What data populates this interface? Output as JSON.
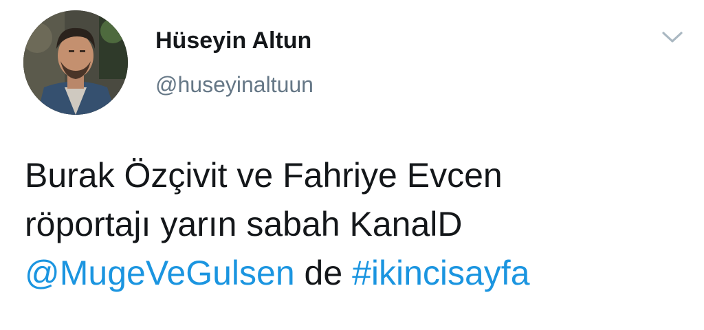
{
  "tweet": {
    "author_name": "Hüseyin Altun",
    "author_handle": "@huseyinaltuun",
    "menu_icon": "chevron-down-icon",
    "lines": [
      "Burak Özçivit ve Fahriye Evcen",
      "röportajı yarın sabah KanalD"
    ],
    "mention": "@MugeVeGulsen",
    "connector": " de ",
    "hashtag": "#ikincisayfa"
  },
  "colors": {
    "text": "#14171a",
    "secondary": "#657786",
    "link": "#1b95e0",
    "chevron": "#aab8c2"
  }
}
